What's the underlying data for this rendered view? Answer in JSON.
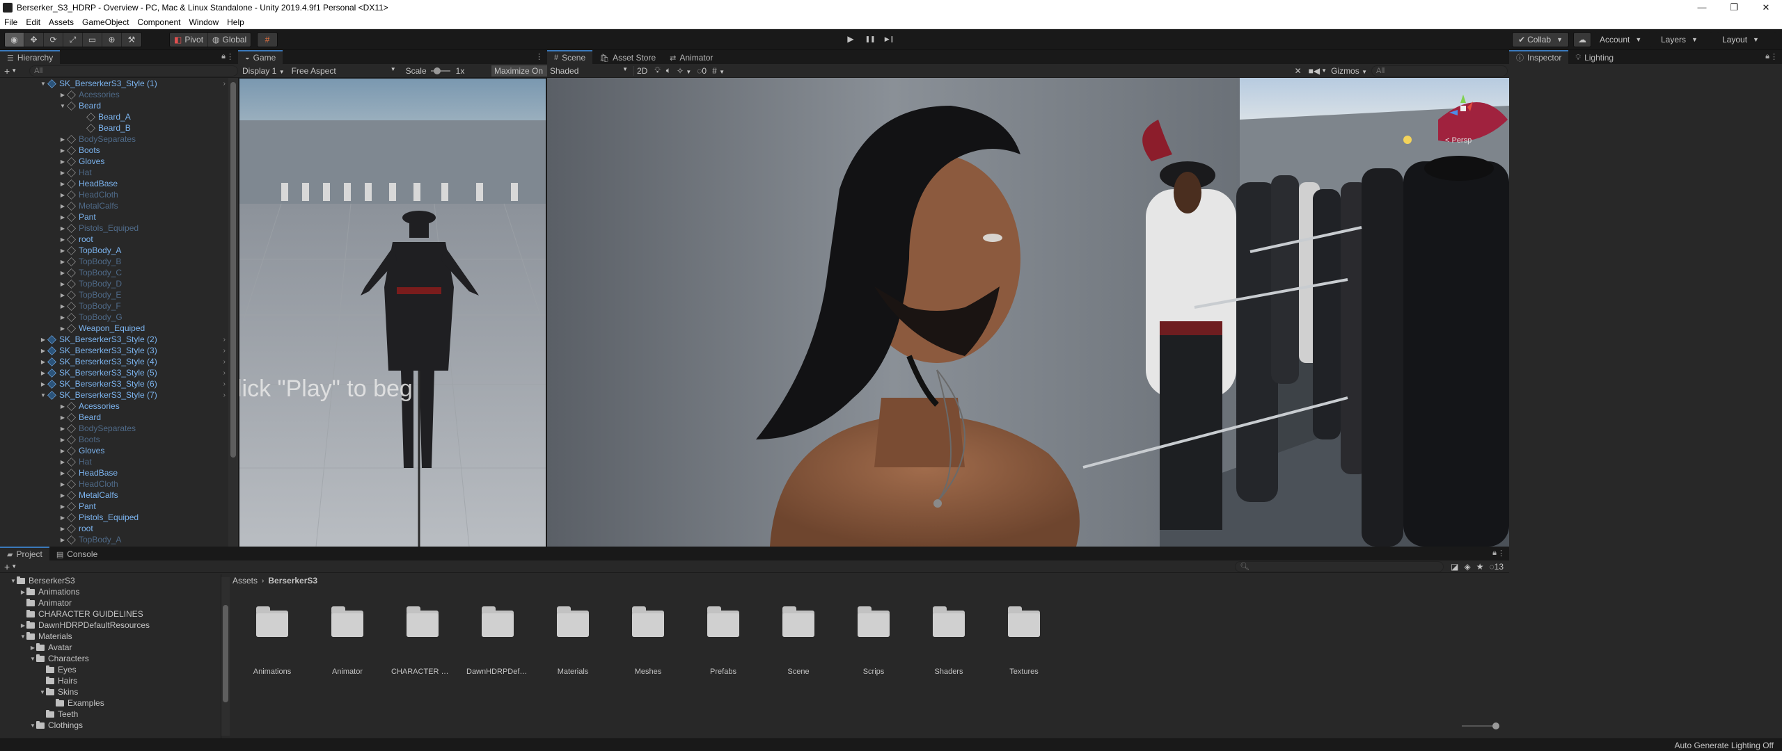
{
  "window": {
    "title": "Berserker_S3_HDRP - Overview - PC, Mac & Linux Standalone - Unity 2019.4.9f1 Personal <DX11>",
    "minimize": "—",
    "maximize": "❐",
    "close": "✕"
  },
  "menu": [
    "File",
    "Edit",
    "Assets",
    "GameObject",
    "Component",
    "Window",
    "Help"
  ],
  "toolbar": {
    "pivot_label": "Pivot",
    "global_label": "Global",
    "play_icon": "▶",
    "pause_icon": "❚❚",
    "step_icon": "▶❙",
    "collab_label": "Collab",
    "account_label": "Account",
    "layers_label": "Layers",
    "layout_label": "Layout"
  },
  "hierarchy": {
    "tab_label": "Hierarchy",
    "search_placeholder": "All",
    "add_label": "+",
    "rows": [
      {
        "label": "SK_BerserkerS3_Style (1)",
        "indent": 0,
        "state": "root",
        "expanded": true
      },
      {
        "label": "Acessories",
        "indent": 1,
        "state": "off",
        "expanded": false
      },
      {
        "label": "Beard",
        "indent": 1,
        "state": "on",
        "expanded": true
      },
      {
        "label": "Beard_A",
        "indent": 2,
        "state": "on",
        "expanded": null
      },
      {
        "label": "Beard_B",
        "indent": 2,
        "state": "on",
        "expanded": null
      },
      {
        "label": "BodySeparates",
        "indent": 1,
        "state": "off",
        "expanded": false
      },
      {
        "label": "Boots",
        "indent": 1,
        "state": "on",
        "expanded": false
      },
      {
        "label": "Gloves",
        "indent": 1,
        "state": "on",
        "expanded": false
      },
      {
        "label": "Hat",
        "indent": 1,
        "state": "off",
        "expanded": false
      },
      {
        "label": "HeadBase",
        "indent": 1,
        "state": "on",
        "expanded": false
      },
      {
        "label": "HeadCloth",
        "indent": 1,
        "state": "off",
        "expanded": false
      },
      {
        "label": "MetalCalfs",
        "indent": 1,
        "state": "off",
        "expanded": false
      },
      {
        "label": "Pant",
        "indent": 1,
        "state": "on",
        "expanded": false
      },
      {
        "label": "Pistols_Equiped",
        "indent": 1,
        "state": "off",
        "expanded": false
      },
      {
        "label": "root",
        "indent": 1,
        "state": "on",
        "expanded": false
      },
      {
        "label": "TopBody_A",
        "indent": 1,
        "state": "on",
        "expanded": false
      },
      {
        "label": "TopBody_B",
        "indent": 1,
        "state": "off",
        "expanded": false
      },
      {
        "label": "TopBody_C",
        "indent": 1,
        "state": "off",
        "expanded": false
      },
      {
        "label": "TopBody_D",
        "indent": 1,
        "state": "off",
        "expanded": false
      },
      {
        "label": "TopBody_E",
        "indent": 1,
        "state": "off",
        "expanded": false
      },
      {
        "label": "TopBody_F",
        "indent": 1,
        "state": "off",
        "expanded": false
      },
      {
        "label": "TopBody_G",
        "indent": 1,
        "state": "off",
        "expanded": false
      },
      {
        "label": "Weapon_Equiped",
        "indent": 1,
        "state": "on",
        "expanded": false
      },
      {
        "label": "SK_BerserkerS3_Style (2)",
        "indent": 0,
        "state": "root",
        "expanded": false
      },
      {
        "label": "SK_BerserkerS3_Style (3)",
        "indent": 0,
        "state": "root",
        "expanded": false
      },
      {
        "label": "SK_BerserkerS3_Style (4)",
        "indent": 0,
        "state": "root",
        "expanded": false
      },
      {
        "label": "SK_BerserkerS3_Style (5)",
        "indent": 0,
        "state": "root",
        "expanded": false
      },
      {
        "label": "SK_BerserkerS3_Style (6)",
        "indent": 0,
        "state": "root",
        "expanded": false
      },
      {
        "label": "SK_BerserkerS3_Style (7)",
        "indent": 0,
        "state": "root",
        "expanded": true
      },
      {
        "label": "Acessories",
        "indent": 1,
        "state": "on",
        "expanded": false
      },
      {
        "label": "Beard",
        "indent": 1,
        "state": "on",
        "expanded": false
      },
      {
        "label": "BodySeparates",
        "indent": 1,
        "state": "off",
        "expanded": false
      },
      {
        "label": "Boots",
        "indent": 1,
        "state": "off",
        "expanded": false
      },
      {
        "label": "Gloves",
        "indent": 1,
        "state": "on",
        "expanded": false
      },
      {
        "label": "Hat",
        "indent": 1,
        "state": "off",
        "expanded": false
      },
      {
        "label": "HeadBase",
        "indent": 1,
        "state": "on",
        "expanded": false
      },
      {
        "label": "HeadCloth",
        "indent": 1,
        "state": "off",
        "expanded": false
      },
      {
        "label": "MetalCalfs",
        "indent": 1,
        "state": "on",
        "expanded": false
      },
      {
        "label": "Pant",
        "indent": 1,
        "state": "on",
        "expanded": false
      },
      {
        "label": "Pistols_Equiped",
        "indent": 1,
        "state": "on",
        "expanded": false
      },
      {
        "label": "root",
        "indent": 1,
        "state": "on",
        "expanded": false
      },
      {
        "label": "TopBody_A",
        "indent": 1,
        "state": "off",
        "expanded": false
      }
    ]
  },
  "game": {
    "tab_label": "Game",
    "display": "Display 1",
    "aspect": "Free Aspect",
    "scale_label": "Scale",
    "scale_value": "1x",
    "maximize_label": "Maximize On",
    "overlay_text": "lick \"Play\" to beg"
  },
  "scene": {
    "tabs": [
      "Scene",
      "Asset Store",
      "Animator"
    ],
    "shading": "Shaded",
    "mode_2d": "2D",
    "hidden_count": "0",
    "gizmos_label": "Gizmos",
    "search_placeholder": "All",
    "persp_label": "< Persp"
  },
  "inspector": {
    "tabs": [
      "Inspector",
      "Lighting"
    ]
  },
  "project": {
    "tabs": [
      "Project",
      "Console"
    ],
    "add_label": "+",
    "breadcrumb": [
      "Assets",
      "BerserkerS3"
    ],
    "hidden_count": "13",
    "tree": [
      {
        "label": "BerserkerS3",
        "indent": 0,
        "expanded": true
      },
      {
        "label": "Animations",
        "indent": 1,
        "expanded": false
      },
      {
        "label": "Animator",
        "indent": 1,
        "expanded": null
      },
      {
        "label": "CHARACTER GUIDELINES",
        "indent": 1,
        "expanded": null
      },
      {
        "label": "DawnHDRPDefaultResources",
        "indent": 1,
        "expanded": false
      },
      {
        "label": "Materials",
        "indent": 1,
        "expanded": true
      },
      {
        "label": "Avatar",
        "indent": 2,
        "expanded": false
      },
      {
        "label": "Characters",
        "indent": 2,
        "expanded": true
      },
      {
        "label": "Eyes",
        "indent": 3,
        "expanded": null
      },
      {
        "label": "Hairs",
        "indent": 3,
        "expanded": null
      },
      {
        "label": "Skins",
        "indent": 3,
        "expanded": true
      },
      {
        "label": "Examples",
        "indent": 4,
        "expanded": null
      },
      {
        "label": "Teeth",
        "indent": 3,
        "expanded": null
      },
      {
        "label": "Clothings",
        "indent": 2,
        "expanded": true
      }
    ],
    "assets": [
      "Animations",
      "Animator",
      "CHARACTER GUI...",
      "DawnHDRPDefaul...",
      "Materials",
      "Meshes",
      "Prefabs",
      "Scene",
      "Scrips",
      "Shaders",
      "Textures"
    ]
  },
  "status": {
    "text": "Auto Generate Lighting Off"
  },
  "colors": {
    "accent": "#3a79bb",
    "prefab_text": "#7cb4ef",
    "prefab_inactive": "#4f6a88"
  }
}
